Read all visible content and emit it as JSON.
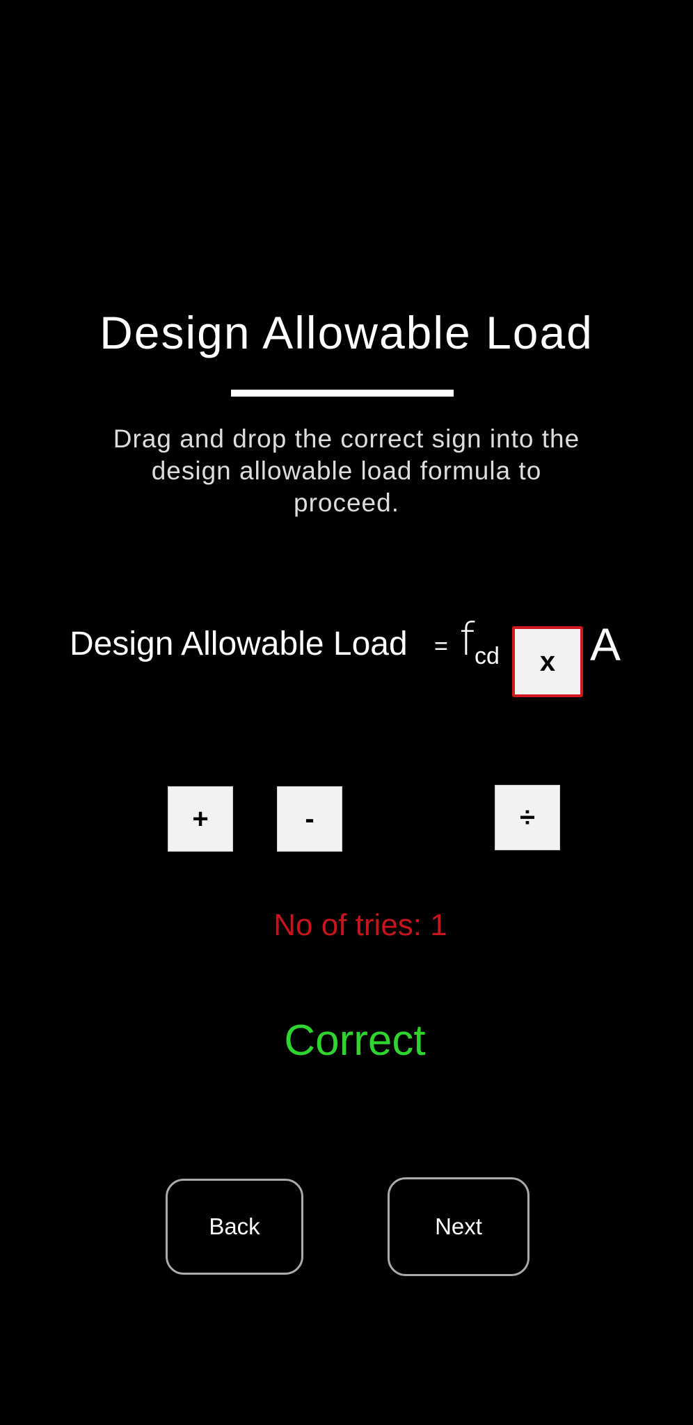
{
  "header": {
    "title": "Design Allowable Load",
    "instructions": "Drag and drop the correct sign into the design allowable load formula to proceed."
  },
  "formula": {
    "label": "Design Allowable Load",
    "equals": "=",
    "f_symbol": "f",
    "f_subscript": "cd",
    "slot_value": "x",
    "a_symbol": "A"
  },
  "sign_tiles": {
    "plus": "+",
    "minus": "-",
    "divide": "÷"
  },
  "status": {
    "tries": "No of tries: 1",
    "result": "Correct"
  },
  "navigation": {
    "back_label": "Back",
    "next_label": "Next"
  },
  "colors": {
    "background": "#000000",
    "slot_border": "#d0181f",
    "tries_text": "#c4161c",
    "result_text": "#2fd42f"
  }
}
